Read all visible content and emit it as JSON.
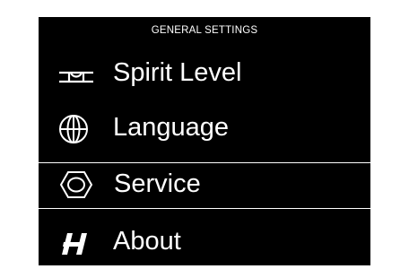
{
  "header": {
    "title": "GENERAL SETTINGS"
  },
  "menu": {
    "items": [
      {
        "label": "Spirit Level",
        "icon": "spirit-level-icon",
        "selected": false
      },
      {
        "label": "Language",
        "icon": "globe-icon",
        "selected": false
      },
      {
        "label": "Service",
        "icon": "hexagon-nut-icon",
        "selected": true
      },
      {
        "label": "About",
        "icon": "h-logo-icon",
        "selected": false
      }
    ]
  },
  "colors": {
    "background": "#000000",
    "text": "#ffffff",
    "selection_border": "#ffffff"
  }
}
